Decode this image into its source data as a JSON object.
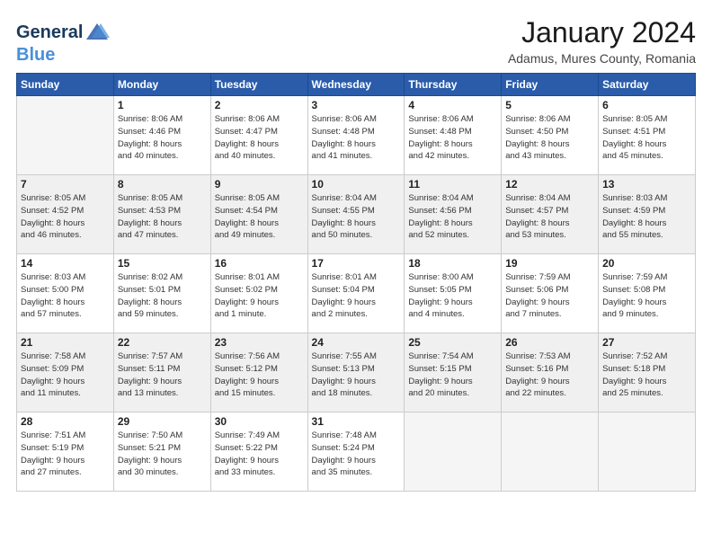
{
  "logo": {
    "line1": "General",
    "line2": "Blue"
  },
  "title": "January 2024",
  "subtitle": "Adamus, Mures County, Romania",
  "days_header": [
    "Sunday",
    "Monday",
    "Tuesday",
    "Wednesday",
    "Thursday",
    "Friday",
    "Saturday"
  ],
  "weeks": [
    {
      "shaded": false,
      "days": [
        {
          "num": "",
          "info": ""
        },
        {
          "num": "1",
          "info": "Sunrise: 8:06 AM\nSunset: 4:46 PM\nDaylight: 8 hours\nand 40 minutes."
        },
        {
          "num": "2",
          "info": "Sunrise: 8:06 AM\nSunset: 4:47 PM\nDaylight: 8 hours\nand 40 minutes."
        },
        {
          "num": "3",
          "info": "Sunrise: 8:06 AM\nSunset: 4:48 PM\nDaylight: 8 hours\nand 41 minutes."
        },
        {
          "num": "4",
          "info": "Sunrise: 8:06 AM\nSunset: 4:48 PM\nDaylight: 8 hours\nand 42 minutes."
        },
        {
          "num": "5",
          "info": "Sunrise: 8:06 AM\nSunset: 4:50 PM\nDaylight: 8 hours\nand 43 minutes."
        },
        {
          "num": "6",
          "info": "Sunrise: 8:05 AM\nSunset: 4:51 PM\nDaylight: 8 hours\nand 45 minutes."
        }
      ]
    },
    {
      "shaded": true,
      "days": [
        {
          "num": "7",
          "info": "Sunrise: 8:05 AM\nSunset: 4:52 PM\nDaylight: 8 hours\nand 46 minutes."
        },
        {
          "num": "8",
          "info": "Sunrise: 8:05 AM\nSunset: 4:53 PM\nDaylight: 8 hours\nand 47 minutes."
        },
        {
          "num": "9",
          "info": "Sunrise: 8:05 AM\nSunset: 4:54 PM\nDaylight: 8 hours\nand 49 minutes."
        },
        {
          "num": "10",
          "info": "Sunrise: 8:04 AM\nSunset: 4:55 PM\nDaylight: 8 hours\nand 50 minutes."
        },
        {
          "num": "11",
          "info": "Sunrise: 8:04 AM\nSunset: 4:56 PM\nDaylight: 8 hours\nand 52 minutes."
        },
        {
          "num": "12",
          "info": "Sunrise: 8:04 AM\nSunset: 4:57 PM\nDaylight: 8 hours\nand 53 minutes."
        },
        {
          "num": "13",
          "info": "Sunrise: 8:03 AM\nSunset: 4:59 PM\nDaylight: 8 hours\nand 55 minutes."
        }
      ]
    },
    {
      "shaded": false,
      "days": [
        {
          "num": "14",
          "info": "Sunrise: 8:03 AM\nSunset: 5:00 PM\nDaylight: 8 hours\nand 57 minutes."
        },
        {
          "num": "15",
          "info": "Sunrise: 8:02 AM\nSunset: 5:01 PM\nDaylight: 8 hours\nand 59 minutes."
        },
        {
          "num": "16",
          "info": "Sunrise: 8:01 AM\nSunset: 5:02 PM\nDaylight: 9 hours\nand 1 minute."
        },
        {
          "num": "17",
          "info": "Sunrise: 8:01 AM\nSunset: 5:04 PM\nDaylight: 9 hours\nand 2 minutes."
        },
        {
          "num": "18",
          "info": "Sunrise: 8:00 AM\nSunset: 5:05 PM\nDaylight: 9 hours\nand 4 minutes."
        },
        {
          "num": "19",
          "info": "Sunrise: 7:59 AM\nSunset: 5:06 PM\nDaylight: 9 hours\nand 7 minutes."
        },
        {
          "num": "20",
          "info": "Sunrise: 7:59 AM\nSunset: 5:08 PM\nDaylight: 9 hours\nand 9 minutes."
        }
      ]
    },
    {
      "shaded": true,
      "days": [
        {
          "num": "21",
          "info": "Sunrise: 7:58 AM\nSunset: 5:09 PM\nDaylight: 9 hours\nand 11 minutes."
        },
        {
          "num": "22",
          "info": "Sunrise: 7:57 AM\nSunset: 5:11 PM\nDaylight: 9 hours\nand 13 minutes."
        },
        {
          "num": "23",
          "info": "Sunrise: 7:56 AM\nSunset: 5:12 PM\nDaylight: 9 hours\nand 15 minutes."
        },
        {
          "num": "24",
          "info": "Sunrise: 7:55 AM\nSunset: 5:13 PM\nDaylight: 9 hours\nand 18 minutes."
        },
        {
          "num": "25",
          "info": "Sunrise: 7:54 AM\nSunset: 5:15 PM\nDaylight: 9 hours\nand 20 minutes."
        },
        {
          "num": "26",
          "info": "Sunrise: 7:53 AM\nSunset: 5:16 PM\nDaylight: 9 hours\nand 22 minutes."
        },
        {
          "num": "27",
          "info": "Sunrise: 7:52 AM\nSunset: 5:18 PM\nDaylight: 9 hours\nand 25 minutes."
        }
      ]
    },
    {
      "shaded": false,
      "days": [
        {
          "num": "28",
          "info": "Sunrise: 7:51 AM\nSunset: 5:19 PM\nDaylight: 9 hours\nand 27 minutes."
        },
        {
          "num": "29",
          "info": "Sunrise: 7:50 AM\nSunset: 5:21 PM\nDaylight: 9 hours\nand 30 minutes."
        },
        {
          "num": "30",
          "info": "Sunrise: 7:49 AM\nSunset: 5:22 PM\nDaylight: 9 hours\nand 33 minutes."
        },
        {
          "num": "31",
          "info": "Sunrise: 7:48 AM\nSunset: 5:24 PM\nDaylight: 9 hours\nand 35 minutes."
        },
        {
          "num": "",
          "info": ""
        },
        {
          "num": "",
          "info": ""
        },
        {
          "num": "",
          "info": ""
        }
      ]
    }
  ]
}
